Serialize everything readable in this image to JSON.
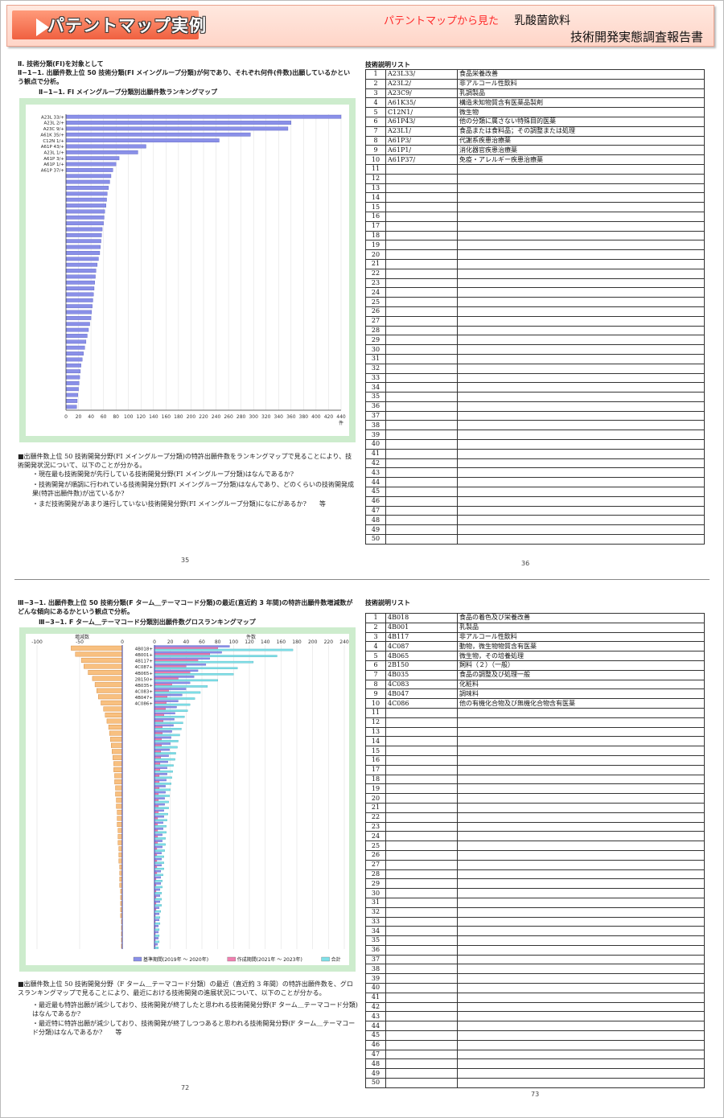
{
  "banner": {
    "title": "パテントマップ実例",
    "red_label": "パテントマップから見た",
    "subject": "乳酸菌飲料",
    "report": "技術開発実態調査報告書"
  },
  "page1": {
    "heading": "Ⅱ. 技術分類(FI)を対象として",
    "subheading": "Ⅱ−1−1. 出願件数上位 50 技術分類(FI メイングループ分類)が何であり、それぞれ何件(件数)出願しているかという観点で分析。",
    "chart_title": "Ⅱ−1−1. FI メイングループ分類別出願件数ランキングマップ",
    "notes": [
      "■出願件数上位 50 技術開発分野(FI メイングループ分類)の特許出願件数をランキングマップで見ることにより、技術開発状況について、以下のことが分かる。",
      "・現在最も技術開発が先行している技術開発分野(FI メイングループ分類)はなんであるか?",
      "・技術開発が順調に行われている技術開発分野(FI メイングループ分類)はなんであり、どのくらいの技術開発成果(特許出願件数)が出ているか?",
      "・まだ技術開発があまり進行していない技術開発分野(FI メイングループ分類)になにがあるか?　　等"
    ],
    "page_no_left": "35",
    "list_title": "技術説明リスト",
    "list": [
      {
        "no": "1",
        "code": "A23L33/",
        "desc": "食品栄養改善"
      },
      {
        "no": "2",
        "code": "A23L2/",
        "desc": "非アルコール性飲料"
      },
      {
        "no": "3",
        "code": "A23C9/",
        "desc": "乳調製品"
      },
      {
        "no": "4",
        "code": "A61K35/",
        "desc": "構造未知物質含有医薬品製剤"
      },
      {
        "no": "5",
        "code": "C12N1/",
        "desc": "微生物"
      },
      {
        "no": "6",
        "code": "A61P43/",
        "desc": "他の分類に属さない特殊目的医薬"
      },
      {
        "no": "7",
        "code": "A23L1/",
        "desc": "食品または食料品；その調整または処理"
      },
      {
        "no": "8",
        "code": "A61P3/",
        "desc": "代謝系疾患治療薬"
      },
      {
        "no": "9",
        "code": "A61P1/",
        "desc": "消化器官疾患治療薬"
      },
      {
        "no": "10",
        "code": "A61P37/",
        "desc": "免疫・アレルギー疾患治療薬"
      }
    ],
    "page_no_right": "36"
  },
  "page2": {
    "heading": "Ⅲ−3−1. 出願件数上位 50 技術分類(F ターム＿テーマコード分類)の最近(直近約 3 年間)の特許出願件数増減数がどんな傾向にあるかという観点で分析。",
    "chart_title": "Ⅲ−3−1. F ターム＿テーマコード分類別出願件数グロスランキングマップ",
    "notes": [
      "■出願件数上位 50 技術開発分野（F ターム＿テーマコード分類）の最近（直近約 3 年間）の特許出願件数を、グロスランキングマップで見ることにより、最近における技術開発の進展状況について、以下のことが分かる。",
      "・最近最も特許出願が減少しており、技術開発が終了したと思われる技術開発分野(F ターム＿テーマコード分類)はなんであるか?",
      "・最近特に特許出願が減少しており、技術開発が終了しつつあると思われる技術開発分野(F ターム＿テーマコード分類)はなんであるか?　　等"
    ],
    "page_no_left": "72",
    "list_title": "技術説明リスト",
    "list": [
      {
        "no": "1",
        "code": "4B018",
        "desc": "食品の着色及び栄養改善"
      },
      {
        "no": "2",
        "code": "4B001",
        "desc": "乳製品"
      },
      {
        "no": "3",
        "code": "4B117",
        "desc": "非アルコール性飲料"
      },
      {
        "no": "4",
        "code": "4C087",
        "desc": "動物，微生物物質含有医薬"
      },
      {
        "no": "5",
        "code": "4B065",
        "desc": "微生物，その培養処理"
      },
      {
        "no": "6",
        "code": "2B150",
        "desc": "飼料（２）（一般）"
      },
      {
        "no": "7",
        "code": "4B035",
        "desc": "食品の調整及び処理一般"
      },
      {
        "no": "8",
        "code": "4C083",
        "desc": "化粧料"
      },
      {
        "no": "9",
        "code": "4B047",
        "desc": "調味料"
      },
      {
        "no": "10",
        "code": "4C086",
        "desc": "他の有機化合物及び無機化合物含有医薬"
      }
    ],
    "legend": {
      "base": "基準期間(2019年 〜 2020年)",
      "recent": "作成期間(2021年 〜 2023年)",
      "total": "合計"
    },
    "axis_left_label": "増減数",
    "axis_right_label": "件数",
    "page_no_right": "73"
  },
  "chart_data": [
    {
      "type": "bar",
      "orientation": "horizontal",
      "title": "Ⅱ−1−1. FI メイングループ分類別出願件数ランキングマップ",
      "xlabel": "件",
      "xlim": [
        0,
        440
      ],
      "xticks": [
        0,
        20,
        40,
        60,
        80,
        100,
        120,
        140,
        160,
        180,
        200,
        220,
        240,
        260,
        280,
        300,
        320,
        340,
        360,
        380,
        400,
        420,
        440
      ],
      "categories": [
        "A23L 33/+",
        "A23L 2/+",
        "A23C 9/+",
        "A61K 35/+",
        "C12N 1/+",
        "A61P 43/+",
        "A23L 1/+",
        "A61P 3/+",
        "A61P 1/+",
        "A61P 37/+"
      ],
      "values": [
        440,
        360,
        355,
        295,
        245,
        128,
        115,
        85,
        80,
        75,
        72,
        70,
        68,
        66,
        65,
        64,
        62,
        61,
        60,
        58,
        57,
        56,
        55,
        54,
        52,
        50,
        48,
        47,
        46,
        45,
        44,
        43,
        42,
        41,
        40,
        38,
        36,
        34,
        32,
        30,
        28,
        26,
        24,
        23,
        22,
        21,
        20,
        19,
        18,
        17
      ]
    },
    {
      "type": "bar",
      "orientation": "horizontal",
      "title": "Ⅲ−3−1. F ターム＿テーマコード分類別出願件数グロスランキングマップ",
      "left_axis": {
        "label": "増減数",
        "xlim": [
          -100,
          0
        ],
        "ticks": [
          -100,
          -50,
          0
        ]
      },
      "right_axis": {
        "label": "件数",
        "xlim": [
          0,
          240
        ],
        "ticks": [
          0,
          20,
          40,
          60,
          80,
          100,
          120,
          140,
          160,
          180,
          200,
          220,
          240
        ]
      },
      "categories": [
        "4B018+",
        "4B001+",
        "4B117+",
        "4C087+",
        "4B065+",
        "2B150+",
        "4B035+",
        "4C083+",
        "4B047+",
        "4C086+"
      ],
      "series": [
        {
          "name": "基準期間(2019年 〜 2020年)",
          "values": [
            95,
            85,
            70,
            65,
            55,
            50,
            45,
            40,
            35,
            30,
            28,
            26,
            25,
            24,
            22,
            21,
            20,
            19,
            18,
            17,
            16,
            16,
            15,
            14,
            14,
            13,
            13,
            12,
            12,
            11,
            11,
            10,
            10,
            10,
            9,
            9,
            9,
            8,
            8,
            8,
            7,
            7,
            7,
            6,
            6,
            6,
            5,
            5,
            5,
            4
          ]
        },
        {
          "name": "作成期間(2021年 〜 2023年)",
          "values": [
            80,
            70,
            55,
            40,
            45,
            30,
            22,
            18,
            16,
            15,
            14,
            12,
            11,
            10,
            10,
            9,
            9,
            8,
            8,
            7,
            7,
            6,
            6,
            6,
            5,
            5,
            5,
            5,
            4,
            4,
            4,
            4,
            4,
            3,
            3,
            3,
            3,
            3,
            2,
            2,
            2,
            2,
            2,
            2,
            1,
            1,
            1,
            1,
            1,
            1
          ]
        },
        {
          "name": "合計",
          "values": [
            175,
            155,
            125,
            105,
            100,
            80,
            67,
            58,
            51,
            45,
            42,
            38,
            36,
            34,
            32,
            30,
            29,
            27,
            26,
            24,
            23,
            22,
            21,
            20,
            19,
            18,
            18,
            17,
            16,
            15,
            15,
            14,
            14,
            13,
            12,
            12,
            12,
            11,
            10,
            10,
            9,
            9,
            9,
            8,
            7,
            7,
            6,
            6,
            6,
            5
          ]
        },
        {
          "name": "増減数",
          "values": [
            -60,
            -55,
            -48,
            -45,
            -40,
            -35,
            -32,
            -30,
            -28,
            -25,
            -22,
            -20,
            -18,
            -16,
            -15,
            -14,
            -13,
            -12,
            -11,
            -10,
            -10,
            -9,
            -9,
            -8,
            -8,
            -7,
            -7,
            -6,
            -6,
            -6,
            -5,
            -5,
            -5,
            -4,
            -4,
            -4,
            -3,
            -3,
            -3,
            -3,
            -2,
            -2,
            -2,
            -2,
            -2,
            -1,
            -1,
            -1,
            -1,
            -1
          ]
        }
      ]
    }
  ]
}
